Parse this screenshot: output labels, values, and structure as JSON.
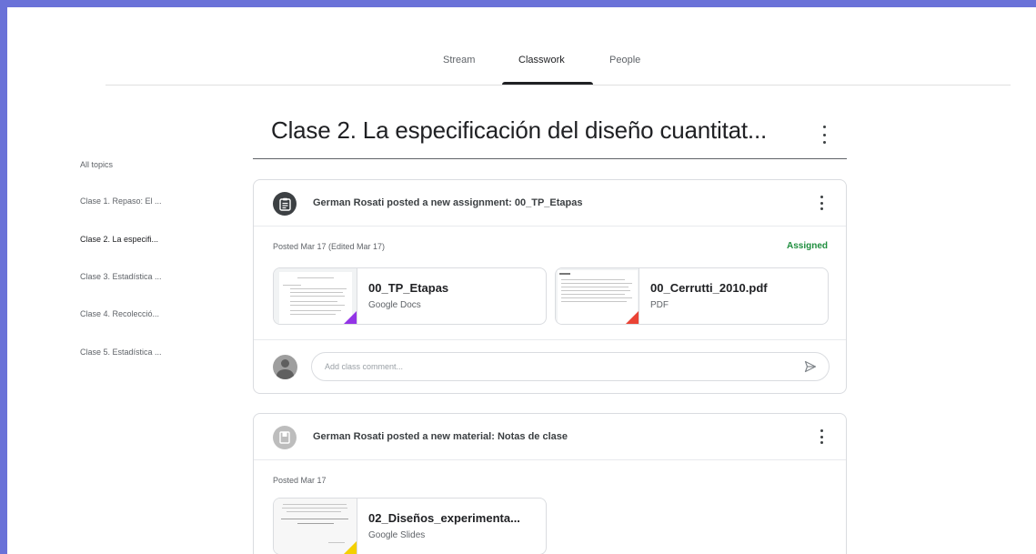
{
  "tabs": [
    {
      "label": "Stream"
    },
    {
      "label": "Classwork"
    },
    {
      "label": "People"
    }
  ],
  "active_tab": "Classwork",
  "topic": {
    "title": "Clase 2. La especificación del diseño cuantitat..."
  },
  "sidebar": {
    "items": [
      {
        "label": "All topics"
      },
      {
        "label": "Clase 1. Repaso: El ..."
      },
      {
        "label": "Clase 2. La especifi..."
      },
      {
        "label": "Clase 3. Estadística ..."
      },
      {
        "label": "Clase 4. Recolecció..."
      },
      {
        "label": "Clase 5. Estadística ..."
      }
    ]
  },
  "posts": [
    {
      "header": "German Rosati posted a new assignment: 00_TP_Etapas",
      "icon": "assignment-icon",
      "posted": "Posted Mar 17 (Edited Mar 17)",
      "status": "Assigned",
      "attachments": [
        {
          "title": "00_TP_Etapas",
          "type": "Google Docs",
          "corner_color": "#9334e6"
        },
        {
          "title": "00_Cerrutti_2010.pdf",
          "type": "PDF",
          "corner_color": "#ea4335"
        }
      ],
      "comment_placeholder": "Add class comment..."
    },
    {
      "header": "German Rosati posted a new material: Notas de clase",
      "icon": "material-icon",
      "posted": "Posted Mar 17",
      "attachments": [
        {
          "title": "02_Diseños_experimenta...",
          "type": "Google Slides",
          "corner_color": "#f4d000"
        }
      ]
    }
  ],
  "colors": {
    "background": "#6a72d8",
    "assigned_status": "#1e8e3e"
  }
}
